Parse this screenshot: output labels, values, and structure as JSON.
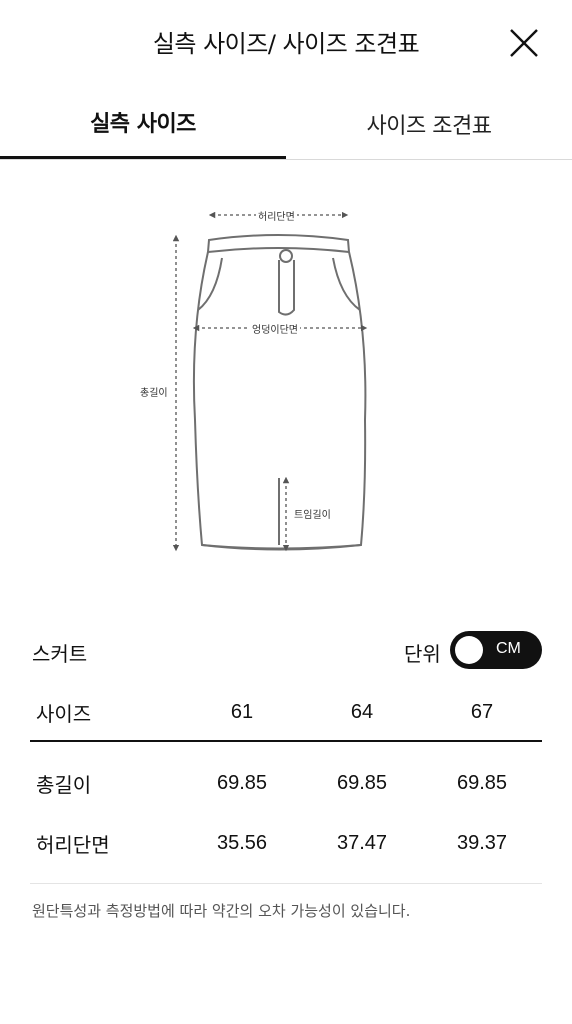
{
  "header": {
    "title": "실측 사이즈/ 사이즈 조견표"
  },
  "tabs": [
    {
      "label": "실측 사이즈",
      "active": true
    },
    {
      "label": "사이즈 조견표",
      "active": false
    }
  ],
  "diagram": {
    "labels": {
      "waist": "허리단면",
      "hip": "엉덩이단면",
      "total_length": "총길이",
      "slit_length": "트임길이"
    }
  },
  "section": {
    "title": "스커트",
    "unit_label": "단위",
    "unit_toggle": "CM"
  },
  "table": {
    "header": {
      "label": "사이즈",
      "values": [
        "61",
        "64",
        "67"
      ]
    },
    "rows": [
      {
        "label": "총길이",
        "values": [
          "69.85",
          "69.85",
          "69.85"
        ]
      },
      {
        "label": "허리단면",
        "values": [
          "35.56",
          "37.47",
          "39.37"
        ]
      }
    ]
  },
  "note": "원단특성과 측정방법에 따라 약간의 오차 가능성이 있습니다.",
  "colors": {
    "primary": "#111111",
    "divider": "#d9d9d9",
    "muted": "#555555",
    "sketch": "#6f6f6f"
  },
  "icons": {
    "close": "close-icon"
  }
}
